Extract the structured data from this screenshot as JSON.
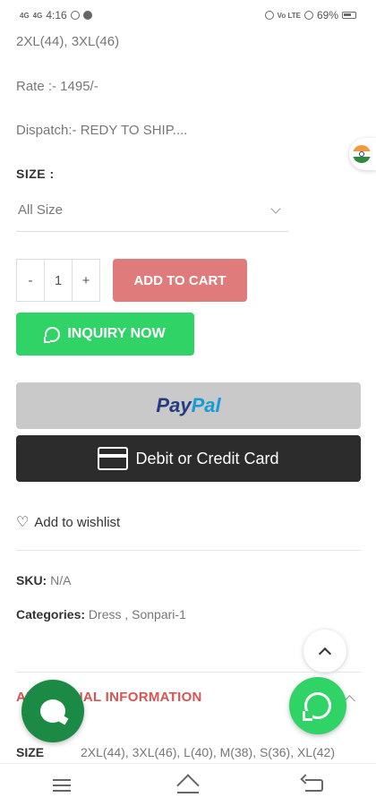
{
  "status_bar": {
    "signal_1": "4G",
    "signal_2": "4G",
    "time": "4:16",
    "network_right": "Vo LTE",
    "battery": "69%"
  },
  "product": {
    "sizes_line": "2XL(44), 3XL(46)",
    "rate": "Rate :- 1495/-",
    "dispatch": "Dispatch:- REDY TO SHIP...."
  },
  "size_selector": {
    "label": "SIZE :",
    "selected": "All Size"
  },
  "quantity": {
    "minus": "-",
    "value": "1",
    "plus": "+"
  },
  "buttons": {
    "add_to_cart": "ADD TO CART",
    "inquiry": "INQUIRY NOW",
    "paypal_pay": "Pay",
    "paypal_pal": "Pal",
    "card": "Debit or Credit Card"
  },
  "wishlist": {
    "label": "Add to wishlist"
  },
  "meta": {
    "sku_label": "SKU:",
    "sku_value": "N/A",
    "categories_label": "Categories:",
    "categories_value": "Dress , Sonpari-1"
  },
  "additional_info": {
    "title": "ADDITIONAL INFORMATION",
    "spec_key": "SIZE",
    "spec_value": "2XL(44), 3XL(46), L(40), M(38), S(36), XL(42)"
  },
  "colors": {
    "add_to_cart": "#e07b7b",
    "whatsapp": "#2fd366",
    "paypal_bg": "#c9c9c9",
    "card_bg": "#2c2c2c",
    "chat": "#1b8a45",
    "accent_red": "#d9534f"
  },
  "icons": {
    "flag": "india-flag-icon",
    "heart": "heart-icon",
    "whatsapp": "whatsapp-icon",
    "chat": "chat-icon",
    "up": "chevron-up-icon",
    "card": "credit-card-icon"
  }
}
